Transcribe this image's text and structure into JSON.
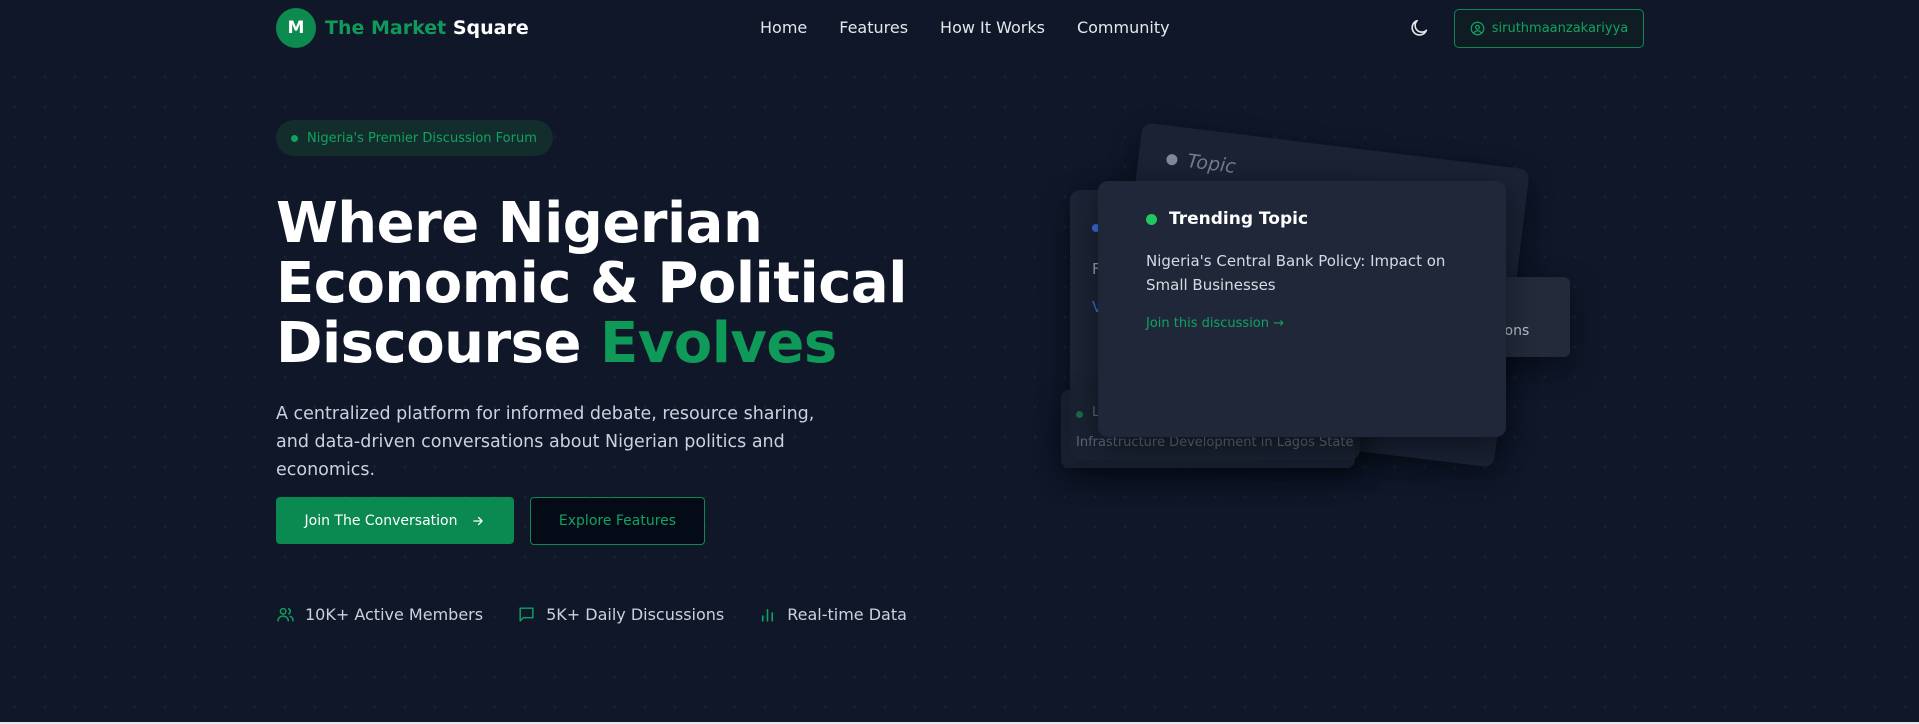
{
  "brand": {
    "badge": "M",
    "name_part1": "The Market",
    "name_part2": "Square",
    "color": "#0d8a4f"
  },
  "nav": {
    "links": [
      "Home",
      "Features",
      "How It Works",
      "Community"
    ],
    "theme_icon": "moon-icon",
    "user_label": "siruthmaanzakariyya",
    "user_icon": "user-circle-icon"
  },
  "hero": {
    "pill": "Nigeria's Premier Discussion Forum",
    "title_line1": "Where Nigerian",
    "title_line2": "Economic & Political",
    "title_line3_prefix": "Discourse",
    "title_line3_accent": "Evolves",
    "subtitle": "A centralized platform for informed debate, resource sharing, and data-driven conversations about Nigerian politics and economics.",
    "primary_button": "Join The Conversation",
    "secondary_button": "Explore Features"
  },
  "stats": [
    {
      "icon": "users-icon",
      "label": "10K+ Active Members"
    },
    {
      "icon": "message-square-icon",
      "label": "5K+ Daily Discussions"
    },
    {
      "icon": "bar-chart-icon",
      "label": "Real-time Data"
    }
  ],
  "cards": {
    "front": {
      "title": "Trending Topic",
      "body": "Nigeria's Central Bank Policy: Impact on Small Businesses",
      "link": "Join this discussion →"
    },
    "back_topic_fragment": "Topic",
    "back_letter_f": "F",
    "back_letter_v": "V",
    "right_fragment": "ications",
    "bottom_letter": "L",
    "bottom_text": "Infrastructure Development in Lagos State"
  },
  "colors": {
    "background": "#0f1729",
    "accent": "#0d8a4f",
    "accent_text": "#10a360",
    "card": "#1f2739",
    "live_dot": "#22c55e"
  }
}
